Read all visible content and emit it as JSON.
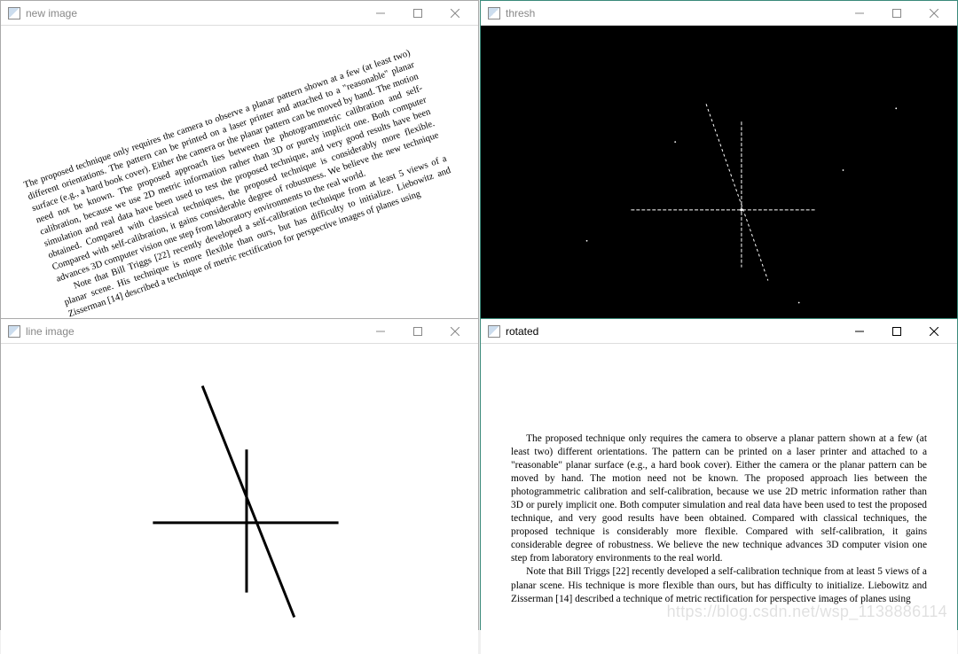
{
  "windows": {
    "newimage": {
      "title": "new image"
    },
    "thresh": {
      "title": "thresh"
    },
    "line": {
      "title": "line image"
    },
    "rotated": {
      "title": "rotated"
    }
  },
  "paragraph1": "The proposed technique only requires the camera to observe a planar pattern shown at a few (at least two) different orientations. The pattern can be printed on a laser printer and attached to a \"reasonable\" planar surface (e.g., a hard book cover). Either the camera or the planar pattern can be moved by hand. The motion need not be known. The proposed approach lies between the photogrammetric calibration and self-calibration, because we use 2D metric information rather than 3D or purely implicit one. Both computer simulation and real data have been used to test the proposed technique, and very good results have been obtained. Compared with classical techniques, the proposed technique is considerably more flexible. Compared with self-calibration, it gains considerable degree of robustness. We believe the new technique advances 3D computer vision one step from laboratory environments to the real world.",
  "paragraph2": "Note that Bill Triggs [22] recently developed a self-calibration technique from at least 5 views of a planar scene. His technique is more flexible than ours, but has difficulty to initialize. Liebowitz and Zisserman [14] described a technique of metric rectification for perspective images of planes using",
  "watermark": "https://blog.csdn.net/wsp_1138886114"
}
